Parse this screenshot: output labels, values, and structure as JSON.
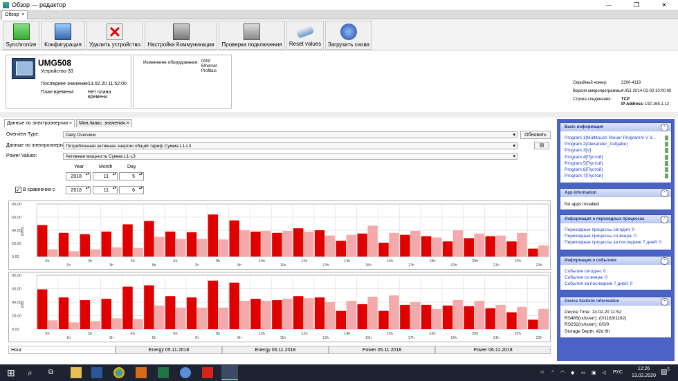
{
  "window": {
    "title": "Обзор — редактор"
  },
  "doc_tab": {
    "label": "Обзор",
    "close": "×"
  },
  "toolbar": {
    "synchronize": "Synchronize",
    "configuration": "Конфигурация",
    "delete_device": "Удалить устройство",
    "comm_settings": "Настройки Коммуникации",
    "check_connection": "Проверка подключения",
    "reset_values": "Reset values",
    "reload": "Загрузить снова"
  },
  "device": {
    "name": "UMG508",
    "device_label": "Устройство-33",
    "last_value_label": "Последнее значение:",
    "last_value": "13.02.20 11:52:00",
    "schedule_label": "План времени:",
    "schedule_value": "Нет плана времени"
  },
  "changes": {
    "label": "Изменение оборудования:",
    "values": [
      "0000",
      "Ethernet",
      "Profibus"
    ]
  },
  "info": {
    "serial_label": "Серийный номер:",
    "serial": "2200-4119",
    "fw_label": "Версия микропрограммы:",
    "fw": "4.051 2014-02-02 10:00:00",
    "conn_label": "Строка соединения:",
    "conn_proto": "TCP",
    "ip_label": "IP Address:",
    "ip": "192.168.1.12"
  },
  "content_tabs": [
    "Данные по электроэнергии ×",
    "Мин./макс. значения ×"
  ],
  "form": {
    "overview_type_label": "Overview Type:",
    "overview_type": "Daily Overview",
    "energy_label": "Данные по электроэнергии",
    "energy_value": "Потребленная активная энергия общий тариф Сумма L1-L3",
    "power_label": "Power Values:",
    "power_value": "Активная мощность Сумма L1-L3",
    "refresh": "Обновить",
    "year_label": "Year",
    "month_label": "Month",
    "day_label": "Day",
    "year": "2018",
    "month": "11",
    "day": "5",
    "compare_label": "В сравнении с",
    "compare_checked": "✓",
    "cmp_year": "2018",
    "cmp_month": "11",
    "cmp_day": "6"
  },
  "chart_data": [
    {
      "type": "bar",
      "ylabel": "[kWh]",
      "ylim": [
        0,
        80
      ],
      "y_ticks": [
        "80,00",
        "60,00",
        "40,00",
        "20,00",
        "0,00"
      ],
      "x_ticks": [
        "0h",
        "1h",
        "2h",
        "3h",
        "4h",
        "5h",
        "6h",
        "7h",
        "8h",
        "9h",
        "10h",
        "11h",
        "12h",
        "13h",
        "14h",
        "15h",
        "16h",
        "17h",
        "18h",
        "19h",
        "20h",
        "21h",
        "22h",
        "23h"
      ],
      "series": [
        {
          "name": "Energy 05.11.2018",
          "color": "#e00000",
          "values": [
            48,
            36,
            34,
            38,
            49,
            54,
            38,
            37,
            64,
            55,
            38,
            36,
            43,
            40,
            24,
            35,
            21,
            33,
            31,
            23,
            28,
            31,
            23,
            12
          ]
        },
        {
          "name": "Energy 06.11.2018",
          "color": "#f4aaaa",
          "values": [
            11,
            8,
            11,
            14,
            13,
            30,
            27,
            27,
            26,
            40,
            39,
            39,
            38,
            32,
            33,
            47,
            36,
            39,
            29,
            40,
            35,
            32,
            36,
            17
          ]
        }
      ]
    },
    {
      "type": "bar",
      "ylabel": "[kW]",
      "ylim": [
        0,
        80
      ],
      "y_ticks": [
        "80,00",
        "60,00",
        "40,00",
        "20,00",
        "0,00"
      ],
      "x_ticks": [
        "0h",
        "1h",
        "2h",
        "3h",
        "4h",
        "5h",
        "6h",
        "7h",
        "8h",
        "9h",
        "10h",
        "11h",
        "12h",
        "13h",
        "14h",
        "15h",
        "16h",
        "17h",
        "18h",
        "19h",
        "20h",
        "21h",
        "22h",
        "23h"
      ],
      "series": [
        {
          "name": "Power 05.11.2018",
          "color": "#e00000",
          "values": [
            59,
            47,
            43,
            45,
            63,
            65,
            49,
            47,
            72,
            69,
            45,
            43,
            49,
            47,
            27,
            37,
            27,
            36,
            36,
            35,
            34,
            31,
            25,
            14
          ]
        },
        {
          "name": "Power 06.11.2018",
          "color": "#f4aaaa",
          "values": [
            13,
            10,
            12,
            16,
            15,
            35,
            32,
            32,
            32,
            42,
            42,
            45,
            46,
            40,
            42,
            48,
            50,
            40,
            30,
            43,
            42,
            36,
            33,
            30
          ]
        }
      ]
    }
  ],
  "table_header": [
    "Hour",
    "Energy 05.11.2018",
    "Energy 06.11.2018",
    "Power 05.11.2018",
    "Power 06.11.2018"
  ],
  "panels": {
    "basic": {
      "title": "Basic информация",
      "items": [
        "Program 1[Multitouch Steuer Programm V 3...",
        "Program 2[Alexander_Aufgabe]",
        "Program 3[V]",
        "Program 4[Пустой]",
        "Program 5[Пустой]",
        "Program 6[Пустой]",
        "Program 7[Пустой]"
      ]
    },
    "apps": {
      "title": "App information",
      "text": "No apps installed"
    },
    "transients": {
      "title": "Информация о переходных процессах",
      "items": [
        "Переходные процессы сегодня: 0",
        "Переходные процессы со вчера: 0",
        "Переходные процессы за последние 7 дней: 0"
      ]
    },
    "events": {
      "title": "Информация о событиях",
      "items": [
        "События сегодня: 0",
        "События со вчера: 0",
        "События за последние 7 дней: 0"
      ]
    },
    "stats": {
      "title": "Device Statistic information",
      "items": [
        "Device Time: 13.02.20 11:52",
        "RS485(rx/tx/err): (0/1163/1162)",
        "RS232(rx/tx/err): 0/0/0",
        "Storage Depth: 42d 6h"
      ]
    }
  },
  "taskbar": {
    "lang": "РУС",
    "time": "12:26",
    "date": "13.02.2020",
    "notif": "5"
  }
}
